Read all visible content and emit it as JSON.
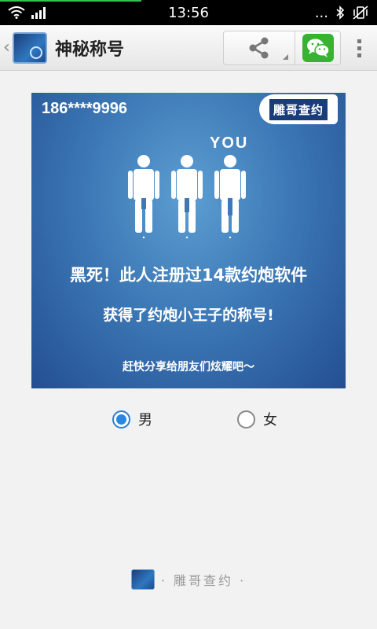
{
  "status_bar": {
    "time": "13:56",
    "dots": "...",
    "icons": [
      "wifi-icon",
      "signal-icon",
      "bluetooth-icon",
      "vibrate-off-icon"
    ]
  },
  "app_bar": {
    "back": "‹",
    "title": "神秘称号",
    "actions": [
      "share-icon",
      "wechat-icon",
      "overflow-menu-icon"
    ]
  },
  "card": {
    "phone": "186****9996",
    "badge": "雕哥查约",
    "you_label": "YOU",
    "line1": "黑死！此人注册过14款约炮软件",
    "line2": "获得了约炮小王子的称号!",
    "line3": "赶快分享给朋友们炫耀吧～",
    "background_color": "#3d79b6"
  },
  "gender": {
    "options": [
      {
        "label": "男",
        "selected": true
      },
      {
        "label": "女",
        "selected": false
      }
    ],
    "accent": "#2a86de"
  },
  "footer": {
    "text": "· 雕哥查约 ·"
  }
}
